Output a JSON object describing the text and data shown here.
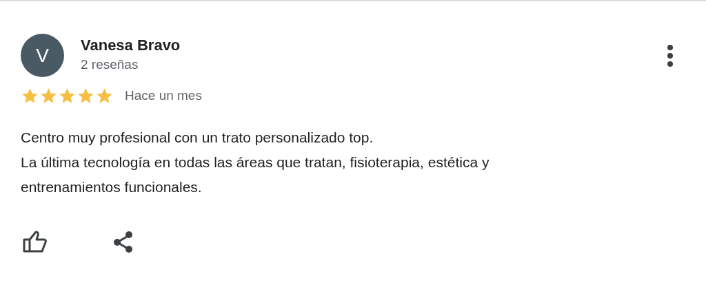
{
  "review": {
    "avatar_letter": "V",
    "author": "Vanesa Bravo",
    "review_count": "2 reseñas",
    "stars": 5,
    "time": "Hace un mes",
    "paragraphs": [
      "Centro muy profesional con un trato personalizado top.",
      "La última tecnología en todas las áreas que tratan, fisioterapia, estética y entrenamientos funcionales."
    ]
  }
}
